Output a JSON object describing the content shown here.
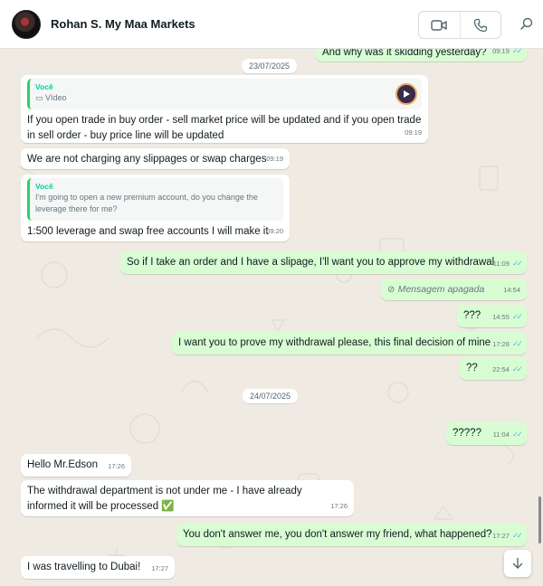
{
  "header": {
    "contact_name": "Rohan S. My Maa Markets",
    "icons": [
      "video-call-icon",
      "voice-call-icon",
      "search-icon"
    ]
  },
  "dates": [
    "23/07/2025",
    "24/07/2025"
  ],
  "messages": [
    {
      "dir": "out",
      "text": "And why was it skidding yesterday?",
      "time": "09:19",
      "read": true
    },
    {
      "dir": "in",
      "quote_author": "Você",
      "quote_text": "Vídeo",
      "text": "If you open trade in buy order - sell market price will be updated and if you open trade in sell order - buy price line will be updated",
      "time": "09:19"
    },
    {
      "dir": "in",
      "text": "We are not charging any slippages or swap charges",
      "time": "09:19"
    },
    {
      "dir": "in",
      "quote_author": "Você",
      "quote_text": "I'm going to open a new premium account, do you change the leverage there for me?",
      "text": "1:500 leverage and swap free accounts I will make it",
      "time": "09:20"
    },
    {
      "dir": "out",
      "text": "So if I take an order and I have a slipage, I'll want you to approve my withdrawal",
      "time": "11:09",
      "read": true
    },
    {
      "dir": "out",
      "text": "Mensagem apagada",
      "time": "14:54",
      "deleted": true
    },
    {
      "dir": "out",
      "text": "???",
      "time": "14:55",
      "read": true
    },
    {
      "dir": "out",
      "text": "I want you to prove my withdrawal please, this final decision of mine",
      "time": "17:28",
      "read": true
    },
    {
      "dir": "out",
      "text": "??",
      "time": "22:54",
      "read": true
    },
    {
      "dir": "out",
      "text": "?????",
      "time": "11:04",
      "read": true
    },
    {
      "dir": "in",
      "text": "Hello Mr.Edson",
      "time": "17:26"
    },
    {
      "dir": "in",
      "text": "The withdrawal department is not under me - I have already informed it will be processed",
      "emoji": "✅",
      "time": "17:26"
    },
    {
      "dir": "out",
      "text": "You don't answer me, you don't answer my friend, what happened?",
      "time": "17:27",
      "read": true
    },
    {
      "dir": "in",
      "text": "I was travelling to Dubai!",
      "time": "17:27"
    }
  ],
  "colors": {
    "incoming_bubble": "#ffffff",
    "outgoing_bubble": "#d9fdd3",
    "chat_background": "#efeae2",
    "read_ticks": "#53bdeb",
    "quote_accent": "#06cf9c"
  }
}
